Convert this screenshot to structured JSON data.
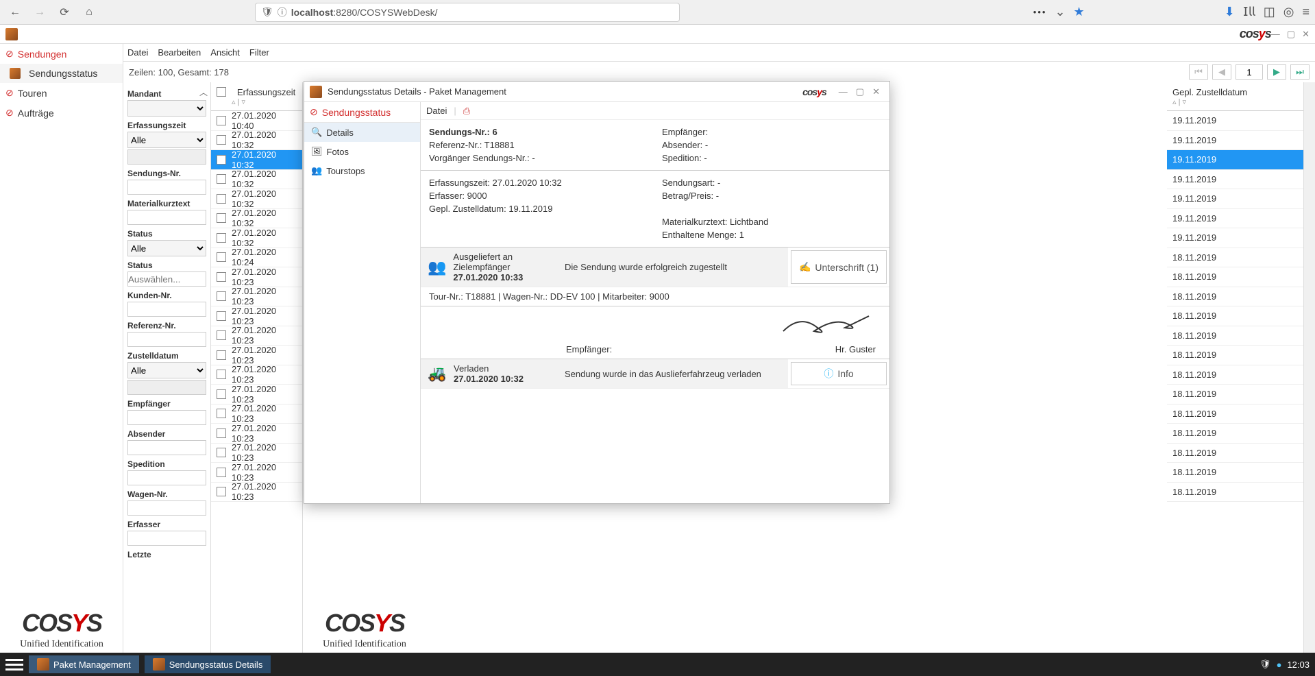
{
  "browser": {
    "url_host": "localhost",
    "url_port": ":8280",
    "url_path": "/COSYSWebDesk/"
  },
  "app": {
    "logo": "cosys"
  },
  "leftnav": {
    "sendungen": "Sendungen",
    "sendungsstatus": "Sendungsstatus",
    "touren": "Touren",
    "auftraege": "Aufträge"
  },
  "menu": {
    "datei": "Datei",
    "bearbeiten": "Bearbeiten",
    "ansicht": "Ansicht",
    "filter": "Filter"
  },
  "status_line": "Zeilen: 100, Gesamt: 178",
  "pager": {
    "page": "1"
  },
  "filters": {
    "mandant": "Mandant",
    "erfassungszeit": "Erfassungszeit",
    "alle": "Alle",
    "sendungsnr": "Sendungs-Nr.",
    "materialkurztext": "Materialkurztext",
    "status": "Status",
    "status2": "Status",
    "auswahlen_ph": "Auswählen...",
    "kundennr": "Kunden-Nr.",
    "referenznr": "Referenz-Nr.",
    "zustelldatum": "Zustelldatum",
    "empfaenger": "Empfänger",
    "absender": "Absender",
    "spedition": "Spedition",
    "wagennr": "Wagen-Nr.",
    "erfasser": "Erfasser",
    "letzte": "Letzte"
  },
  "tableA": {
    "header": "Erfassungszeit",
    "rows": [
      "27.01.2020 10:40",
      "27.01.2020 10:32",
      "27.01.2020 10:32",
      "27.01.2020 10:32",
      "27.01.2020 10:32",
      "27.01.2020 10:32",
      "27.01.2020 10:32",
      "27.01.2020 10:24",
      "27.01.2020 10:23",
      "27.01.2020 10:23",
      "27.01.2020 10:23",
      "27.01.2020 10:23",
      "27.01.2020 10:23",
      "27.01.2020 10:23",
      "27.01.2020 10:23",
      "27.01.2020 10:23",
      "27.01.2020 10:23",
      "27.01.2020 10:23",
      "27.01.2020 10:23",
      "27.01.2020 10:23"
    ],
    "selected_index": 2
  },
  "tableB": {
    "header": "Gepl. Zustelldatum",
    "rows": [
      "19.11.2019",
      "19.11.2019",
      "19.11.2019",
      "19.11.2019",
      "19.11.2019",
      "19.11.2019",
      "19.11.2019",
      "18.11.2019",
      "18.11.2019",
      "18.11.2019",
      "18.11.2019",
      "18.11.2019",
      "18.11.2019",
      "18.11.2019",
      "18.11.2019",
      "18.11.2019",
      "18.11.2019",
      "18.11.2019",
      "18.11.2019",
      "18.11.2019"
    ],
    "selected_index": 2
  },
  "modal": {
    "title": "Sendungsstatus Details - Paket Management",
    "left": {
      "sendungsstatus": "Sendungsstatus",
      "details": "Details",
      "fotos": "Fotos",
      "tourstops": "Tourstops"
    },
    "menu_datei": "Datei",
    "detail": {
      "sendungsnr_label": "Sendungs-Nr.: 6",
      "referenznr": "Referenz-Nr.: T18881",
      "vorgaenger": "Vorgänger Sendungs-Nr.: -",
      "empfaenger": "Empfänger:",
      "absender": "Absender: -",
      "spedition": "Spedition: -",
      "erfassungszeit": "Erfassungszeit: 27.01.2020 10:32",
      "erfasser": "Erfasser: 9000",
      "gepl": "Gepl. Zustelldatum: 19.11.2019",
      "sendungsart": "Sendungsart: -",
      "betrag": "Betrag/Preis: -",
      "materialkurztext": "Materialkurztext: Lichtband",
      "menge": "Enthaltene Menge: 1"
    },
    "status1": {
      "title": "Ausgeliefert an Zielempfänger",
      "time": "27.01.2020 10:33",
      "desc": "Die Sendung wurde erfolgreich zugestellt",
      "btn": "Unterschrift (1)",
      "meta": "Tour-Nr.: T18881 | Wagen-Nr.: DD-EV 100 | Mitarbeiter: 9000",
      "empfaenger_label": "Empfänger:",
      "name": "Hr. Guster"
    },
    "status2": {
      "title": "Verladen",
      "time": "27.01.2020 10:32",
      "desc": "Sendung wurde in das Auslieferfahrzeug verladen",
      "btn": "Info"
    }
  },
  "watermark": {
    "sub": "Unified Identification"
  },
  "taskbar": {
    "item1": "Paket Management",
    "item2": "Sendungsstatus Details",
    "clock": "12:03"
  }
}
